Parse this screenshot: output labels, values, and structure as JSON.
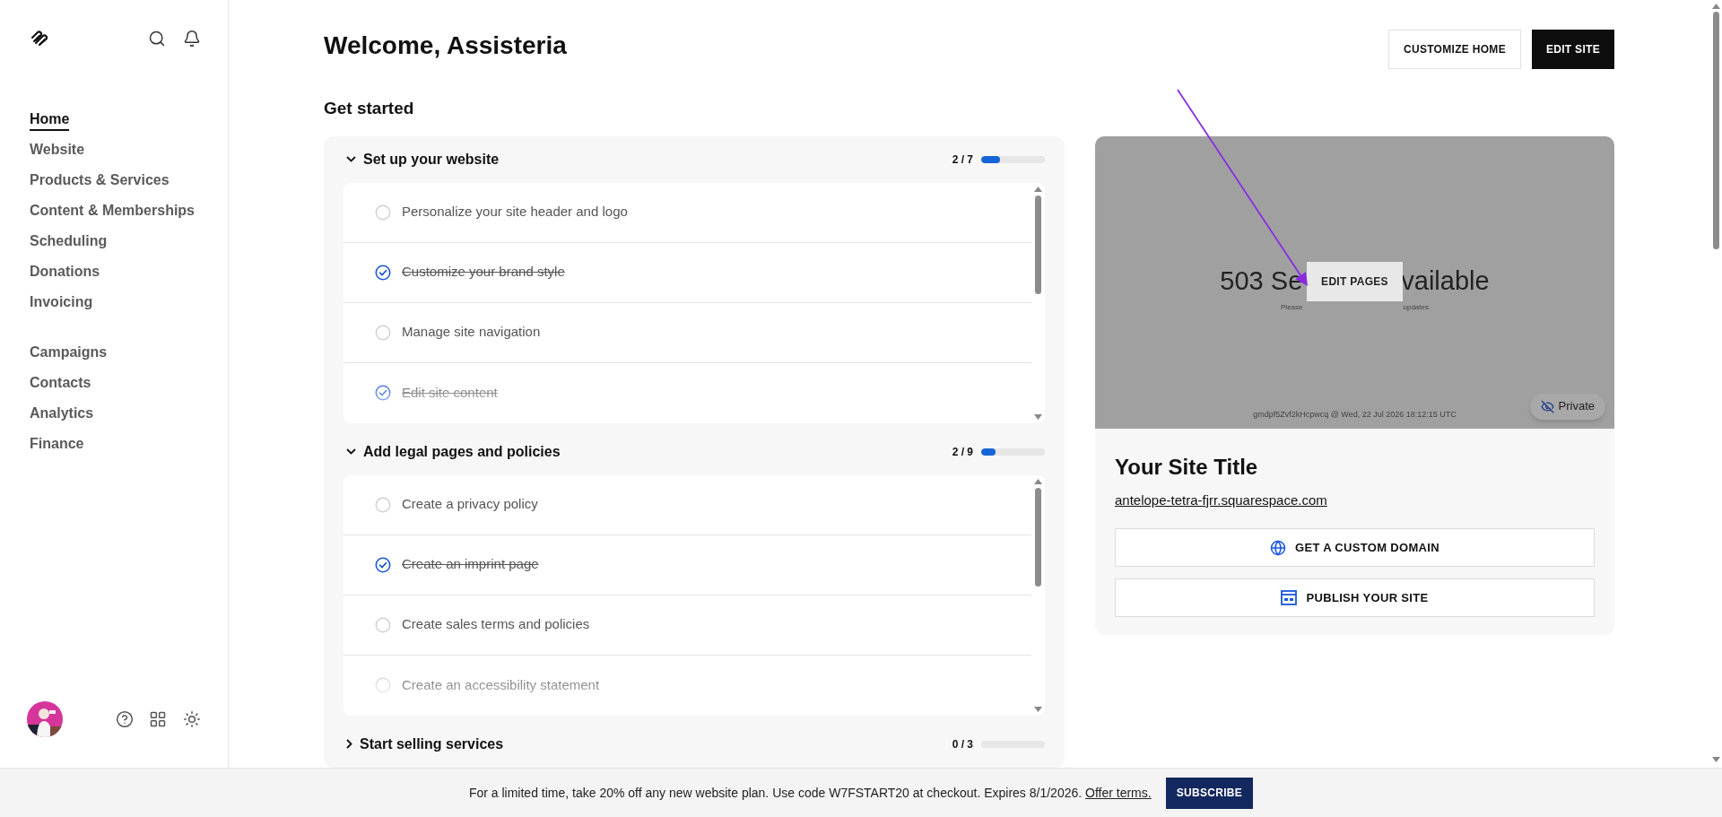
{
  "sidebar": {
    "nav_groups": [
      {
        "items": [
          {
            "label": "Home",
            "selected": true
          },
          {
            "label": "Website",
            "selected": false
          },
          {
            "label": "Products & Services",
            "selected": false
          },
          {
            "label": "Content & Memberships",
            "selected": false
          },
          {
            "label": "Scheduling",
            "selected": false
          },
          {
            "label": "Donations",
            "selected": false
          },
          {
            "label": "Invoicing",
            "selected": false
          }
        ]
      },
      {
        "items": [
          {
            "label": "Campaigns",
            "selected": false
          },
          {
            "label": "Contacts",
            "selected": false
          },
          {
            "label": "Analytics",
            "selected": false
          },
          {
            "label": "Finance",
            "selected": false
          }
        ]
      }
    ]
  },
  "header": {
    "title": "Welcome, Assisteria",
    "buttons": [
      {
        "label": "CUSTOMIZE HOME",
        "kind": "secondary"
      },
      {
        "label": "EDIT SITE",
        "kind": "primary"
      }
    ]
  },
  "get_started": {
    "title": "Get started",
    "sections": [
      {
        "title": "Set up your website",
        "expanded": true,
        "count": "2 / 7",
        "level": 0.29,
        "tasks": [
          {
            "label": "Personalize your site header and logo",
            "checked": false
          },
          {
            "label": "Customize your brand style",
            "checked": true
          },
          {
            "label": "Manage site navigation",
            "checked": false
          },
          {
            "label": "Edit site content",
            "checked": true
          }
        ]
      },
      {
        "title": "Add legal pages and policies",
        "expanded": true,
        "count": "2 / 9",
        "level": 0.22,
        "tasks": [
          {
            "label": "Create a privacy policy",
            "checked": false
          },
          {
            "label": "Create an imprint page",
            "checked": true
          },
          {
            "label": "Create sales terms and policies",
            "checked": false
          },
          {
            "label": "Create an accessibility statement",
            "checked": false
          }
        ]
      },
      {
        "title": "Start selling services",
        "expanded": false,
        "count": "0 / 3"
      }
    ]
  },
  "site_card": {
    "preview": {
      "heading_parts": [
        "503 Se",
        "vailable"
      ],
      "subtext_parts": [
        "Please",
        "updates"
      ],
      "footer": "gmdpf5Zvf2kHcpwcq @ Wed, 22 Jul 2026 18:12:15 UTC",
      "overlay_button": "EDIT PAGES",
      "badge": "Private"
    },
    "title": "Your Site Title",
    "url": "antelope-tetra-fjrr.squarespace.com",
    "actions": [
      {
        "label": "GET A CUSTOM DOMAIN",
        "kind": "domain"
      },
      {
        "label": "PUBLISH YOUR SITE",
        "kind": "publish"
      }
    ]
  },
  "banner": {
    "text": "For a limited time, take 20% off any new website plan. Use code W7FSTART20 at checkout. Expires 8/1/2026. ",
    "link": "Offer terms.",
    "button": "SUBSCRIBE"
  }
}
